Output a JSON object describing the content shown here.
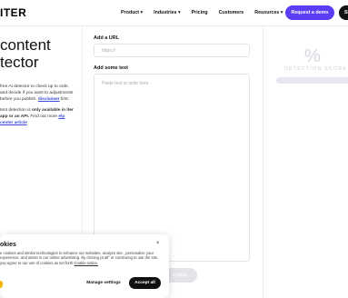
{
  "nav": {
    "logo": "ITER",
    "links": [
      "Product ▾",
      "Industries ▾",
      "Pricing",
      "Customers",
      "Resources ▾"
    ],
    "request_demo": "Request a demo",
    "signin": "Si"
  },
  "left": {
    "title_line1": "content",
    "title_line2": "tector",
    "p1": "free AI detector to check up to ords, and decide if you want to adjustments before you publish.",
    "p1_link": "disclaimer",
    "p1_end": "first.",
    "p2_pre": "tent detection is",
    "p2_bold": "only available in iter app or an API.",
    "p2_post": "Find out more",
    "p2_link": "elp center article"
  },
  "form": {
    "url_label": "Add a URL",
    "url_placeholder": "https://",
    "text_label": "Add some text",
    "text_placeholder": "Paste text or write here",
    "detect_button": "ct text"
  },
  "score": {
    "percent": "%",
    "label": "DETECTION SCORE"
  },
  "cookie": {
    "title": "okies",
    "text": "e cookies and similar technologies to enhance our websites, analyze site , personalize your experience, and assist in our online advertising. By clicking pt all\" or continuing to use the site, you agree to our use of cookies as set forth",
    "notice": "Cookie notice.",
    "close": "×",
    "manage": "Manage settings",
    "accept": "Accept all"
  },
  "colors": {
    "brand_purple": "#5b3df5",
    "link_blue": "#3b4bd6",
    "score_grey": "#d4d6df"
  }
}
